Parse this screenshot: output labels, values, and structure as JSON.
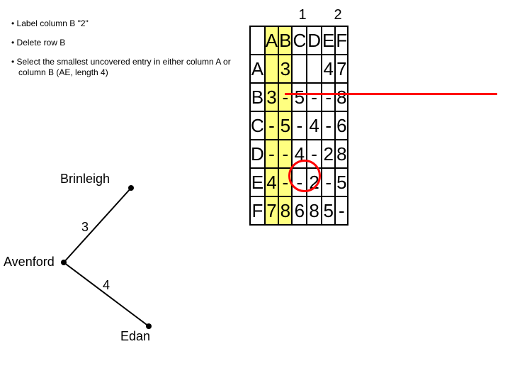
{
  "notes": {
    "n1": "Label column B \"2\"",
    "n2": "Delete row B",
    "n3": "Select the smallest uncovered entry in either column A or column B (AE, length 4)"
  },
  "steps": {
    "s1": "1",
    "s2": "2"
  },
  "headers": {
    "A": "A",
    "B": "B",
    "C": "C",
    "D": "D",
    "E": "E",
    "F": "F"
  },
  "rows": {
    "A": {
      "lab": "A",
      "c1": "",
      "c2": "3",
      "c3": "",
      "c4": "",
      "c5": "4",
      "c6": "7"
    },
    "B": {
      "lab": "B",
      "c1": "3",
      "c2": "-",
      "c3": "5",
      "c4": "-",
      "c5": "-",
      "c6": "8"
    },
    "C": {
      "lab": "C",
      "c1": "-",
      "c2": "5",
      "c3": "-",
      "c4": "4",
      "c5": "-",
      "c6": "6"
    },
    "D": {
      "lab": "D",
      "c1": "-",
      "c2": "-",
      "c3": "4",
      "c4": "-",
      "c5": "2",
      "c6": "8"
    },
    "E": {
      "lab": "E",
      "c1": "4",
      "c2": "-",
      "c3": "-",
      "c4": "2",
      "c5": "-",
      "c6": "5"
    },
    "F": {
      "lab": "F",
      "c1": "7",
      "c2": "8",
      "c3": "6",
      "c4": "8",
      "c5": "5",
      "c6": "-"
    }
  },
  "graph": {
    "brinleigh": "Brinleigh",
    "avenford": "Avenford",
    "edan": "Edan",
    "w_ab": "3",
    "w_ae": "4"
  },
  "chart_data": {
    "type": "table",
    "title": "Distance matrix with Prim/nearest-neighbour step annotations",
    "col_steps": {
      "A": 1,
      "B": 2
    },
    "highlighted_columns": [
      "A",
      "B"
    ],
    "deleted_rows": [
      "B"
    ],
    "circled_cell": {
      "row": "E",
      "col": "A",
      "value": 4
    },
    "matrix": {
      "rows": [
        "A",
        "B",
        "C",
        "D",
        "E",
        "F"
      ],
      "cols": [
        "A",
        "B",
        "C",
        "D",
        "E",
        "F"
      ],
      "values": [
        [
          null,
          3,
          null,
          null,
          4,
          7
        ],
        [
          3,
          null,
          5,
          null,
          null,
          8
        ],
        [
          null,
          5,
          null,
          4,
          null,
          6
        ],
        [
          null,
          null,
          4,
          null,
          2,
          8
        ],
        [
          4,
          null,
          null,
          2,
          null,
          5
        ],
        [
          7,
          8,
          6,
          8,
          5,
          null
        ]
      ]
    },
    "graph_edges": [
      {
        "from": "Avenford",
        "to": "Brinleigh",
        "weight": 3
      },
      {
        "from": "Avenford",
        "to": "Edan",
        "weight": 4
      }
    ]
  }
}
